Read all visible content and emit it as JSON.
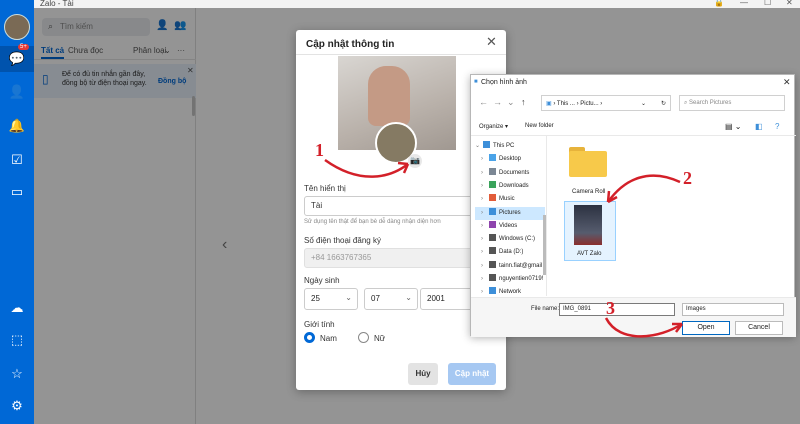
{
  "window": {
    "title": "Zalo - Tài"
  },
  "search": {
    "placeholder": "Tìm kiếm"
  },
  "tabs": {
    "all": "Tất cả",
    "unread": "Chưa đọc",
    "classify": "Phân loại",
    "more": "···"
  },
  "badge": "5+",
  "notice": {
    "text": "Để có đủ tin nhắn gần đây, đồng bộ từ điện thoại ngay.",
    "link": "Đồng bộ"
  },
  "profile": {
    "title": "Cập nhật thông tin",
    "display_name_label": "Tên hiển thị",
    "display_name": "Tài",
    "display_name_hint": "Sử dụng tên thật để bạn bè dễ dàng nhận diện hơn",
    "phone_label": "Số điện thoại đăng ký",
    "phone": "+84 1663767365",
    "dob_label": "Ngày sinh",
    "day": "25",
    "month": "07",
    "year": "2001",
    "gender_label": "Giới tính",
    "male": "Nam",
    "female": "Nữ",
    "gender_selected": "Nam",
    "cancel": "Hủy",
    "save": "Cập nhật"
  },
  "file_dialog": {
    "title": "Chọn hình ảnh",
    "path": [
      "This ...",
      "Pictu..."
    ],
    "search_placeholder": "Search Pictures",
    "organize": "Organize ▾",
    "new_folder": "New folder",
    "nav_items": [
      {
        "label": "This PC",
        "color": "#3d8fd9"
      },
      {
        "label": "Desktop",
        "color": "#4aa3e8"
      },
      {
        "label": "Documents",
        "color": "#7b8794"
      },
      {
        "label": "Downloads",
        "color": "#3aa35b"
      },
      {
        "label": "Music",
        "color": "#e25c3a"
      },
      {
        "label": "Pictures",
        "color": "#3d8fd9"
      },
      {
        "label": "Videos",
        "color": "#8e44ad"
      },
      {
        "label": "Windows (C:)",
        "color": "#555555"
      },
      {
        "label": "Data (D:)",
        "color": "#555555"
      },
      {
        "label": "tainn.fiat@gmail",
        "color": "#555555"
      },
      {
        "label": "nguyentien0719!",
        "color": "#555555"
      },
      {
        "label": "Network",
        "color": "#3d8fd9"
      }
    ],
    "selected_nav": "Pictures",
    "folder_label": "Camera Roll",
    "file_label": "AVT Zalo",
    "filename_label": "File name:",
    "filename": "IMG_0891",
    "filetype": "Images",
    "open": "Open",
    "cancel": "Cancel"
  },
  "step_numbers": [
    "1",
    "2",
    "3"
  ],
  "colors": {
    "accent": "#0068d6",
    "arrow": "#d32029"
  }
}
